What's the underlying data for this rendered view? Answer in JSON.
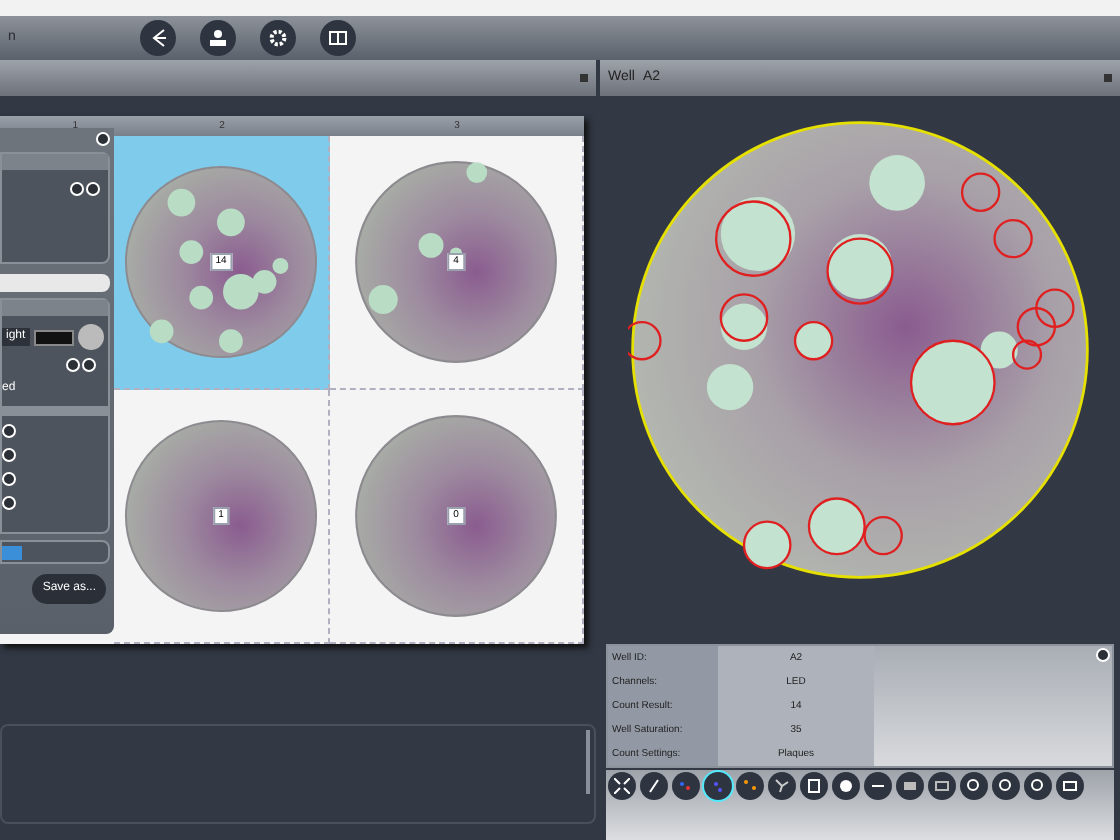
{
  "toolbar": {
    "title": "n"
  },
  "plate": {
    "columns": [
      "1",
      "2",
      "3"
    ],
    "wells": [
      {
        "count": "14",
        "selected": true
      },
      {
        "count": "4",
        "selected": false
      },
      {
        "count": "1",
        "selected": false
      },
      {
        "count": "0",
        "selected": false
      }
    ]
  },
  "side_panel": {
    "light_label": "ight",
    "row_label": "ed",
    "save_button": "Save as..."
  },
  "well_view": {
    "title": "Well",
    "well_id": "A2"
  },
  "well_info": [
    {
      "label": "Well ID:",
      "value": "A2"
    },
    {
      "label": "Channels:",
      "value": "LED"
    },
    {
      "label": "Count Result:",
      "value": "14"
    },
    {
      "label": "Well Saturation:",
      "value": "35"
    },
    {
      "label": "Count Settings:",
      "value": "Plaques"
    }
  ]
}
